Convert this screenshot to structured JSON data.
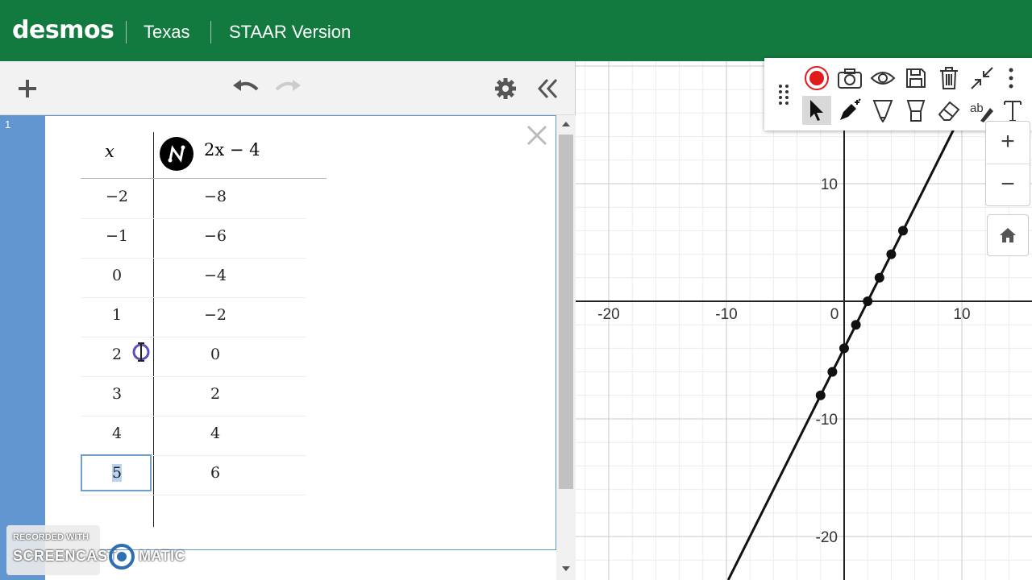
{
  "header": {
    "logo": "desmos",
    "region": "Texas",
    "version": "STAAR Version"
  },
  "expression_list": {
    "expression_index": "1",
    "table": {
      "headers": {
        "x": "x",
        "y": "2x − 4"
      },
      "rows": [
        {
          "x": "−2",
          "y": "−8"
        },
        {
          "x": "−1",
          "y": "−6"
        },
        {
          "x": "0",
          "y": "−4"
        },
        {
          "x": "1",
          "y": "−2"
        },
        {
          "x": "2",
          "y": "0"
        },
        {
          "x": "3",
          "y": "2"
        },
        {
          "x": "4",
          "y": "4"
        },
        {
          "x": "5",
          "y": "6"
        }
      ]
    }
  },
  "graph": {
    "x_ticks": [
      {
        "v": -20,
        "t": "-20"
      },
      {
        "v": -10,
        "t": "-10"
      },
      {
        "v": 0,
        "t": "0"
      },
      {
        "v": 10,
        "t": "10"
      }
    ],
    "y_ticks": [
      {
        "v": 10,
        "t": "10"
      },
      {
        "v": -10,
        "t": "-10"
      },
      {
        "v": -20,
        "t": "-20"
      }
    ],
    "line": {
      "slope": 2,
      "intercept": -4
    },
    "points": [
      [
        -2,
        -8
      ],
      [
        -1,
        -6
      ],
      [
        0,
        -4
      ],
      [
        1,
        -2
      ],
      [
        2,
        0
      ],
      [
        3,
        2
      ],
      [
        4,
        4
      ],
      [
        5,
        6
      ]
    ],
    "colors": {
      "header": "#127a3e",
      "gutter": "#6296d0",
      "record": "#e01b1b"
    }
  },
  "zoom": {
    "plus": "+",
    "minus": "−"
  },
  "watermark": {
    "top": "RECORDED WITH",
    "brand_left": "SCREENCAST",
    "brand_right": "MATIC"
  }
}
